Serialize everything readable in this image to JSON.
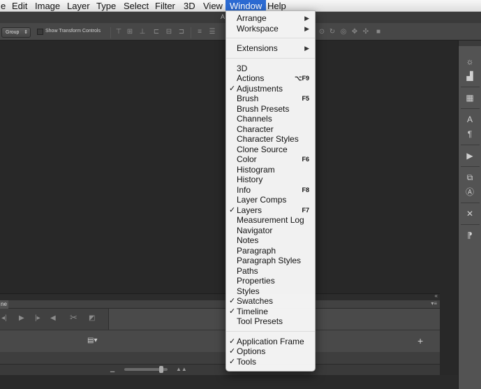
{
  "menubar": {
    "items": [
      "e",
      "Edit",
      "Image",
      "Layer",
      "Type",
      "Select",
      "Filter",
      "3D",
      "View",
      "Window",
      "Help"
    ],
    "active": "Window"
  },
  "options": {
    "group_select": "Group",
    "show_transform_label": "Show Transform Controls",
    "doc_tab_fragment": "A"
  },
  "window_menu": {
    "top": [
      {
        "label": "Arrange",
        "submenu": true
      },
      {
        "label": "Workspace",
        "submenu": true
      }
    ],
    "extensions": {
      "label": "Extensions",
      "submenu": true
    },
    "panels": [
      {
        "label": "3D",
        "checked": false,
        "shortcut": ""
      },
      {
        "label": "Actions",
        "checked": false,
        "shortcut": "⌥F9"
      },
      {
        "label": "Adjustments",
        "checked": true,
        "shortcut": ""
      },
      {
        "label": "Brush",
        "checked": false,
        "shortcut": "F5"
      },
      {
        "label": "Brush Presets",
        "checked": false,
        "shortcut": ""
      },
      {
        "label": "Channels",
        "checked": false,
        "shortcut": ""
      },
      {
        "label": "Character",
        "checked": false,
        "shortcut": ""
      },
      {
        "label": "Character Styles",
        "checked": false,
        "shortcut": ""
      },
      {
        "label": "Clone Source",
        "checked": false,
        "shortcut": ""
      },
      {
        "label": "Color",
        "checked": false,
        "shortcut": "F6"
      },
      {
        "label": "Histogram",
        "checked": false,
        "shortcut": ""
      },
      {
        "label": "History",
        "checked": false,
        "shortcut": ""
      },
      {
        "label": "Info",
        "checked": false,
        "shortcut": "F8"
      },
      {
        "label": "Layer Comps",
        "checked": false,
        "shortcut": ""
      },
      {
        "label": "Layers",
        "checked": true,
        "shortcut": "F7"
      },
      {
        "label": "Measurement Log",
        "checked": false,
        "shortcut": ""
      },
      {
        "label": "Navigator",
        "checked": false,
        "shortcut": ""
      },
      {
        "label": "Notes",
        "checked": false,
        "shortcut": ""
      },
      {
        "label": "Paragraph",
        "checked": false,
        "shortcut": ""
      },
      {
        "label": "Paragraph Styles",
        "checked": false,
        "shortcut": ""
      },
      {
        "label": "Paths",
        "checked": false,
        "shortcut": ""
      },
      {
        "label": "Properties",
        "checked": false,
        "shortcut": ""
      },
      {
        "label": "Styles",
        "checked": false,
        "shortcut": ""
      },
      {
        "label": "Swatches",
        "checked": true,
        "shortcut": ""
      },
      {
        "label": "Timeline",
        "checked": true,
        "shortcut": ""
      },
      {
        "label": "Tool Presets",
        "checked": false,
        "shortcut": ""
      }
    ],
    "bottom": [
      {
        "label": "Application Frame",
        "checked": true
      },
      {
        "label": "Options",
        "checked": true
      },
      {
        "label": "Tools",
        "checked": true
      }
    ],
    "check_glyph": "✓",
    "submenu_glyph": "▶"
  },
  "timeline": {
    "tab_fragment": "ne"
  },
  "colors": {
    "menu_highlight": "#2b6ad2",
    "workspace_bg": "#282828",
    "panel_bg": "#535353"
  },
  "icons": {
    "right_toolbar": [
      "sun-icon",
      "histogram-icon",
      "adjust-icon",
      "character-icon",
      "paragraph-icon",
      "play-icon",
      "clone-source-icon",
      "character-styles-icon",
      "tools-icon",
      "paragraph-styles-icon"
    ]
  }
}
